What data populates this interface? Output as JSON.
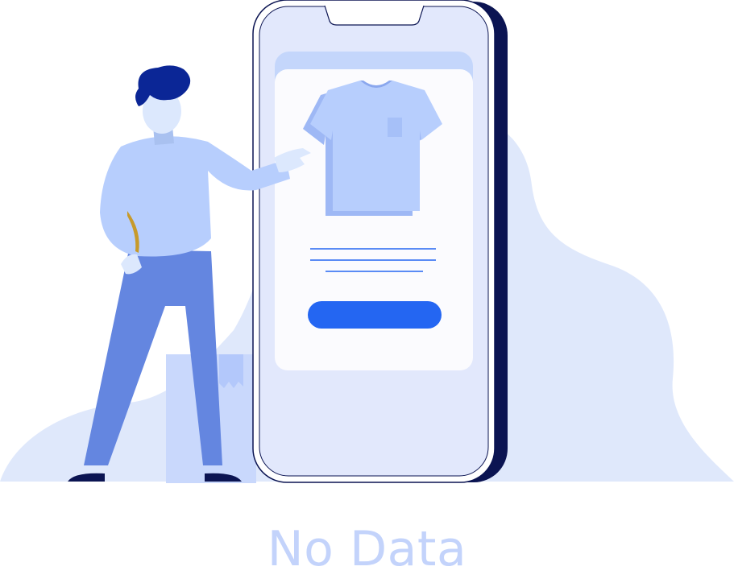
{
  "empty_state": {
    "message": "No Data",
    "illustration": "person-pointing-at-phone-shop",
    "colors": {
      "backdrop": "#dfe8fb",
      "phone_body": "#e2e8fc",
      "phone_frame": "#0b1452",
      "screen_card": "#fbfbfe",
      "shirt": "#b7cefd",
      "accent_button": "#2466f2",
      "text": "#c3d3fb"
    }
  }
}
